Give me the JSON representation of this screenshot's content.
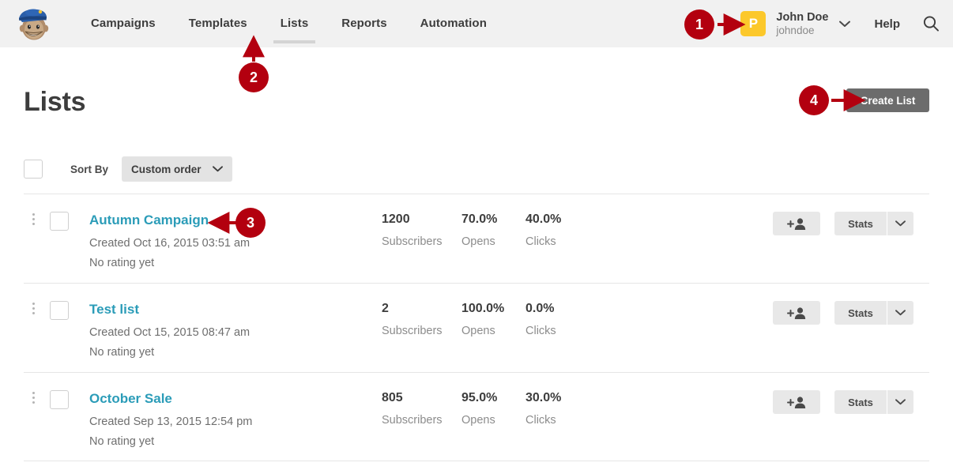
{
  "header": {
    "logo_alt": "mailchimp-freddie-logo",
    "nav": [
      {
        "label": "Campaigns",
        "active": false
      },
      {
        "label": "Templates",
        "active": false
      },
      {
        "label": "Lists",
        "active": true
      },
      {
        "label": "Reports",
        "active": false
      },
      {
        "label": "Automation",
        "active": false
      }
    ],
    "avatar_initial": "P",
    "avatar_color": "#fcc82b",
    "user_name": "John Doe",
    "user_handle": "johndoe",
    "help_label": "Help",
    "search_icon": "search-icon",
    "caret_icon": "chevron-down-icon"
  },
  "page": {
    "title": "Lists",
    "create_button": "Create List"
  },
  "toolbar": {
    "select_all_checkbox": "",
    "sort_label": "Sort By",
    "sort_value": "Custom order",
    "sort_options": [
      "Custom order"
    ],
    "chevron_icon": "chevron-down-icon"
  },
  "columns": {
    "subscribers": "Subscribers",
    "opens": "Opens",
    "clicks": "Clicks"
  },
  "actions": {
    "add_subscriber_icon": "add-person-icon",
    "stats_label": "Stats",
    "dropdown_icon": "chevron-down-icon"
  },
  "lists": [
    {
      "name": "Autumn Campaign",
      "created": "Created Oct 16, 2015 03:51 am",
      "rating": "No rating yet",
      "subscribers": "1200",
      "opens": "70.0%",
      "clicks": "40.0%"
    },
    {
      "name": "Test list",
      "created": "Created Oct 15, 2015 08:47 am",
      "rating": "No rating yet",
      "subscribers": "2",
      "opens": "100.0%",
      "clicks": "0.0%"
    },
    {
      "name": "October Sale",
      "created": "Created Sep 13, 2015 12:54 pm",
      "rating": "No rating yet",
      "subscribers": "805",
      "opens": "95.0%",
      "clicks": "30.0%"
    }
  ],
  "annotations": {
    "color": "#b3000f",
    "markers": [
      {
        "number": "1",
        "target": "avatar"
      },
      {
        "number": "2",
        "target": "nav-lists"
      },
      {
        "number": "3",
        "target": "list-name-autumn-campaign"
      },
      {
        "number": "4",
        "target": "create-list-button"
      }
    ]
  },
  "colors": {
    "link": "#2b9cb8",
    "header_bg": "#f1f1f1",
    "annotation_red": "#b3000f",
    "create_button_bg": "#6c6c6c"
  }
}
